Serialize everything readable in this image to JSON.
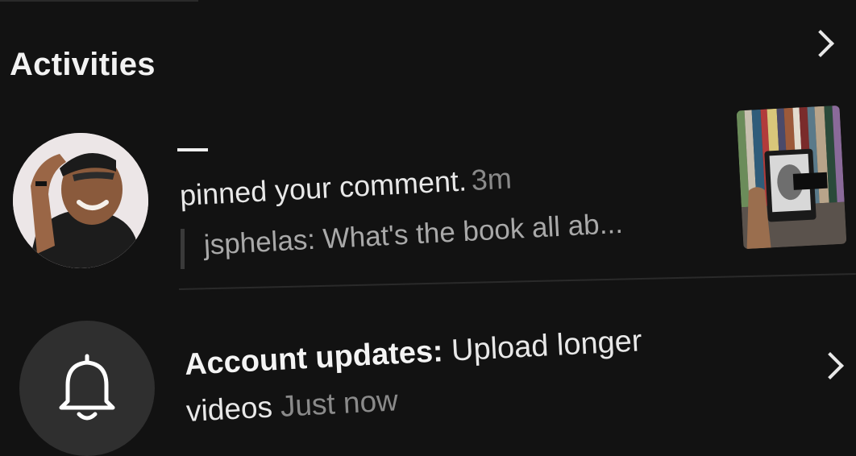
{
  "header": {
    "title": "Activities"
  },
  "activity": {
    "username": "",
    "action_text": "pinned your comment.",
    "time": "3m",
    "comment": "jsphelas: What's the book all ab..."
  },
  "update": {
    "label": "Account updates:",
    "text_part1": "Upload longer",
    "text_part2": "videos",
    "time": "Just now"
  },
  "icons": {
    "activities_chevron": "chevron-right-icon",
    "update_chevron": "chevron-right-icon",
    "bell": "bell-icon"
  },
  "colors": {
    "background": "#121212",
    "primary_text": "#e8e8e8",
    "secondary_text": "#8a8a8a",
    "bell_circle": "#2f2f2f"
  }
}
